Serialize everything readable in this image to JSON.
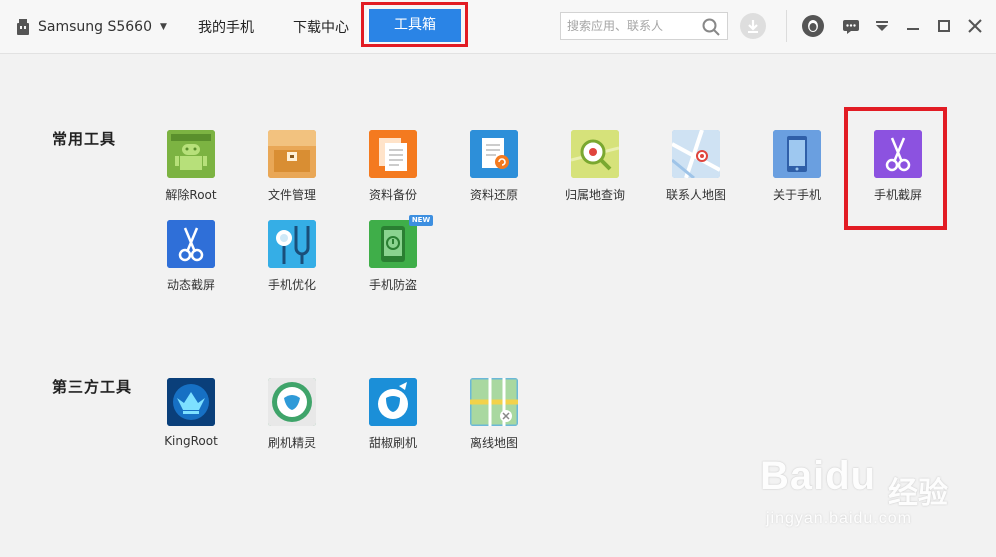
{
  "header": {
    "device_name": "Samsung S5660",
    "tabs": [
      {
        "label": "我的手机"
      },
      {
        "label": "下载中心"
      },
      {
        "label": "工具箱",
        "active": true
      }
    ],
    "search_placeholder": "搜索应用、联系人"
  },
  "sections": [
    {
      "title": "常用工具",
      "tools": [
        {
          "label": "解除Root",
          "icon": "android-unlock-icon",
          "color": "#7cb342"
        },
        {
          "label": "文件管理",
          "icon": "folder-icon",
          "color": "#e8a04a"
        },
        {
          "label": "资料备份",
          "icon": "backup-docs-icon",
          "color": "#f47a1f"
        },
        {
          "label": "资料还原",
          "icon": "restore-doc-icon",
          "color": "#2d8fd9"
        },
        {
          "label": "归属地查询",
          "icon": "location-search-icon",
          "color": "#c8d96a"
        },
        {
          "label": "联系人地图",
          "icon": "contact-map-icon",
          "color": "#9fc4e8"
        },
        {
          "label": "关于手机",
          "icon": "phone-info-icon",
          "color": "#4a8fd9"
        },
        {
          "label": "手机截屏",
          "icon": "scissors-purple-icon",
          "color": "#8a4fd8"
        },
        {
          "label": "动态截屏",
          "icon": "scissors-blue-icon",
          "color": "#2f6fd8"
        },
        {
          "label": "手机优化",
          "icon": "stethoscope-icon",
          "color": "#2ea8e0"
        },
        {
          "label": "手机防盗",
          "icon": "anti-theft-icon",
          "color": "#3fae49",
          "badge": "NEW"
        }
      ]
    },
    {
      "title": "第三方工具",
      "tools": [
        {
          "label": "KingRoot",
          "icon": "kingroot-icon",
          "color": "#0d5fa8"
        },
        {
          "label": "刷机精灵",
          "icon": "flash-wizard-icon",
          "color": "#3fa46a"
        },
        {
          "label": "甜椒刷机",
          "icon": "sweet-pepper-icon",
          "color": "#1b8fd8"
        },
        {
          "label": "离线地图",
          "icon": "offline-map-icon",
          "color": "#6bb8d8"
        }
      ]
    }
  ],
  "watermark": {
    "brand": "Baidu",
    "cn": "经验",
    "url": "jingyan.baidu.com"
  }
}
